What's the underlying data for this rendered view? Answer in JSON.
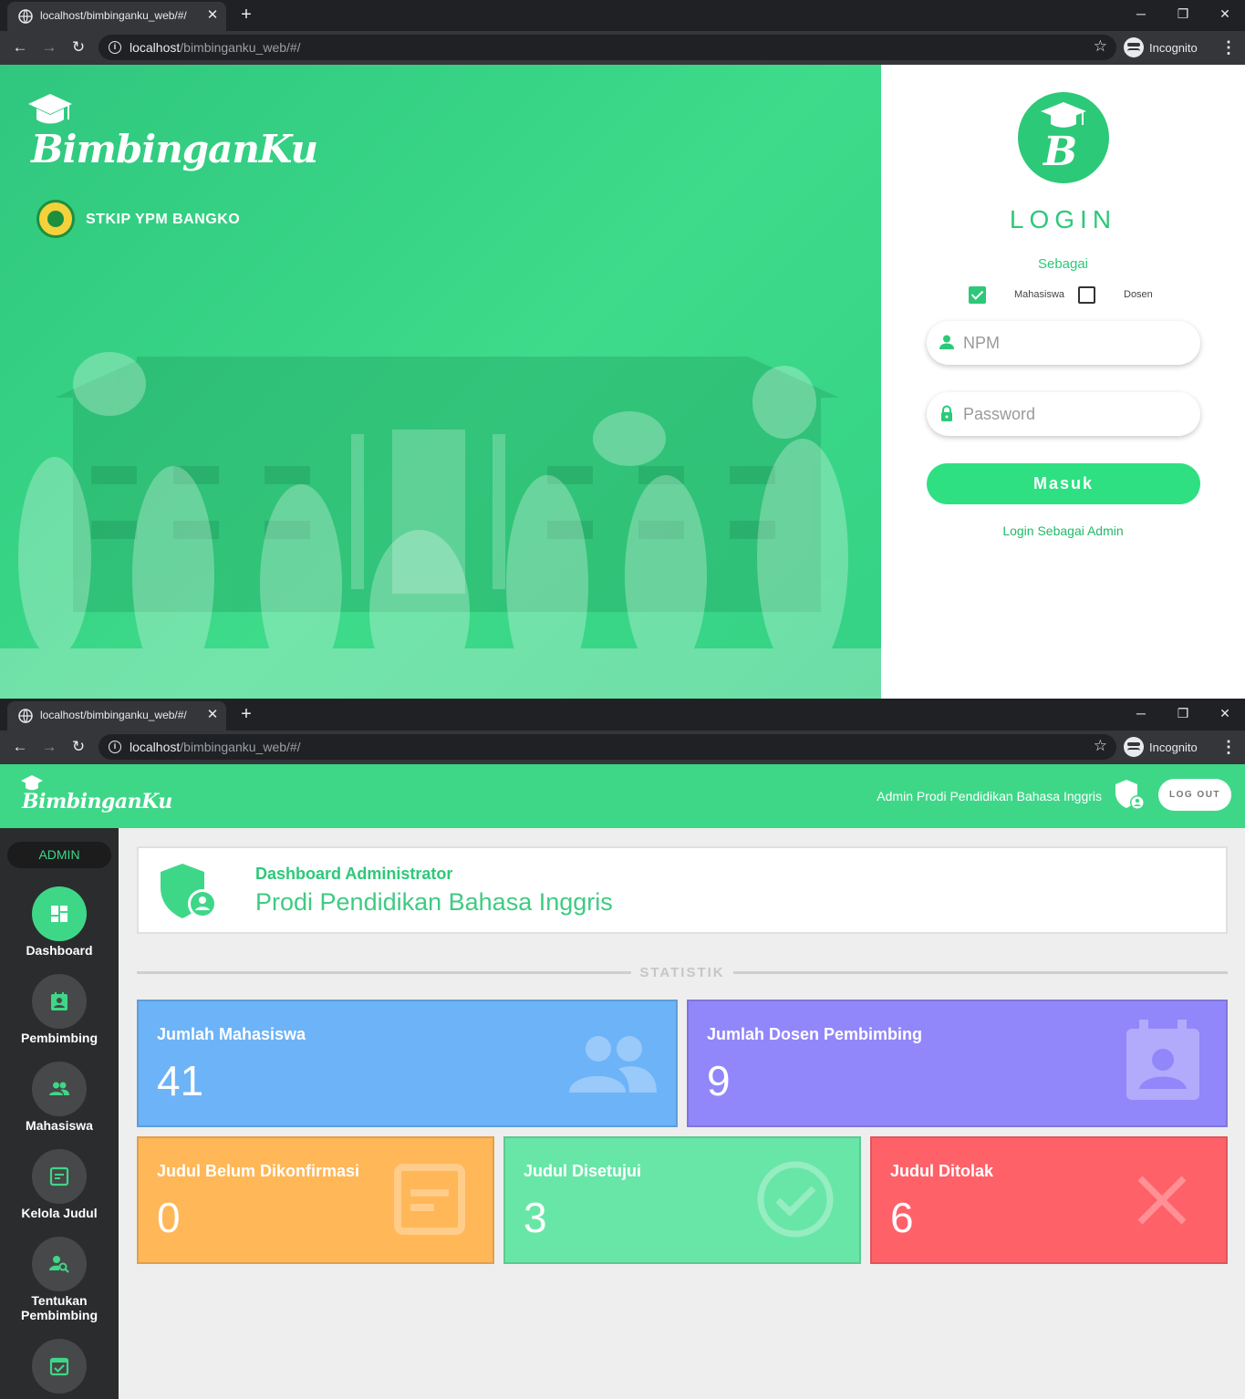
{
  "browser": {
    "tab_title": "localhost/bimbinganku_web/#/",
    "url_host": "localhost",
    "url_path": "/bimbinganku_web/#/",
    "incognito_label": "Incognito"
  },
  "login": {
    "brand_name": "BimbinganKu",
    "school_name": "STKIP YPM BANGKO",
    "logo_letter": "B",
    "title": "LOGIN",
    "role_prompt": "Sebagai",
    "roles": [
      {
        "label": "Mahasiswa",
        "checked": true
      },
      {
        "label": "Dosen",
        "checked": false
      }
    ],
    "npm_placeholder": "NPM",
    "password_placeholder": "Password",
    "submit_label": "Masuk",
    "admin_link": "Login Sebagai Admin",
    "colors": {
      "primary": "#2cc978",
      "button": "#2ee082"
    }
  },
  "dashboard": {
    "brand_name": "BimbinganKu",
    "user_name": "Admin Prodi Pendidikan Bahasa Inggris",
    "logout_label": "LOG OUT",
    "role_label": "ADMIN",
    "nav": [
      {
        "label": "Dashboard",
        "icon": "dashboard-icon",
        "active": true
      },
      {
        "label": "Pembimbing",
        "icon": "contact-calendar-icon",
        "active": false
      },
      {
        "label": "Mahasiswa",
        "icon": "people-icon",
        "active": false
      },
      {
        "label": "Kelola Judul",
        "icon": "document-icon",
        "active": false
      },
      {
        "label": "Tentukan Pembimbing",
        "icon": "person-search-icon",
        "active": false
      },
      {
        "label": "",
        "icon": "event-check-icon",
        "active": false
      }
    ],
    "header": {
      "subtitle": "Dashboard Administrator",
      "title": "Prodi Pendidikan Bahasa Inggris"
    },
    "section_label": "STATISTIK",
    "stats": [
      {
        "label": "Jumlah Mahasiswa",
        "value": "41",
        "color": "#6db3f8",
        "icon": "people-icon"
      },
      {
        "label": "Jumlah Dosen Pembimbing",
        "value": "9",
        "color": "#9187fb",
        "icon": "contact-calendar-icon"
      },
      {
        "label": "Judul Belum Dikonfirmasi",
        "value": "0",
        "color": "#ffb757",
        "icon": "document-icon"
      },
      {
        "label": "Judul Disetujui",
        "value": "3",
        "color": "#68e6a7",
        "icon": "check-circle-icon"
      },
      {
        "label": "Judul Ditolak",
        "value": "6",
        "color": "#ff6169",
        "icon": "close-icon"
      }
    ]
  }
}
